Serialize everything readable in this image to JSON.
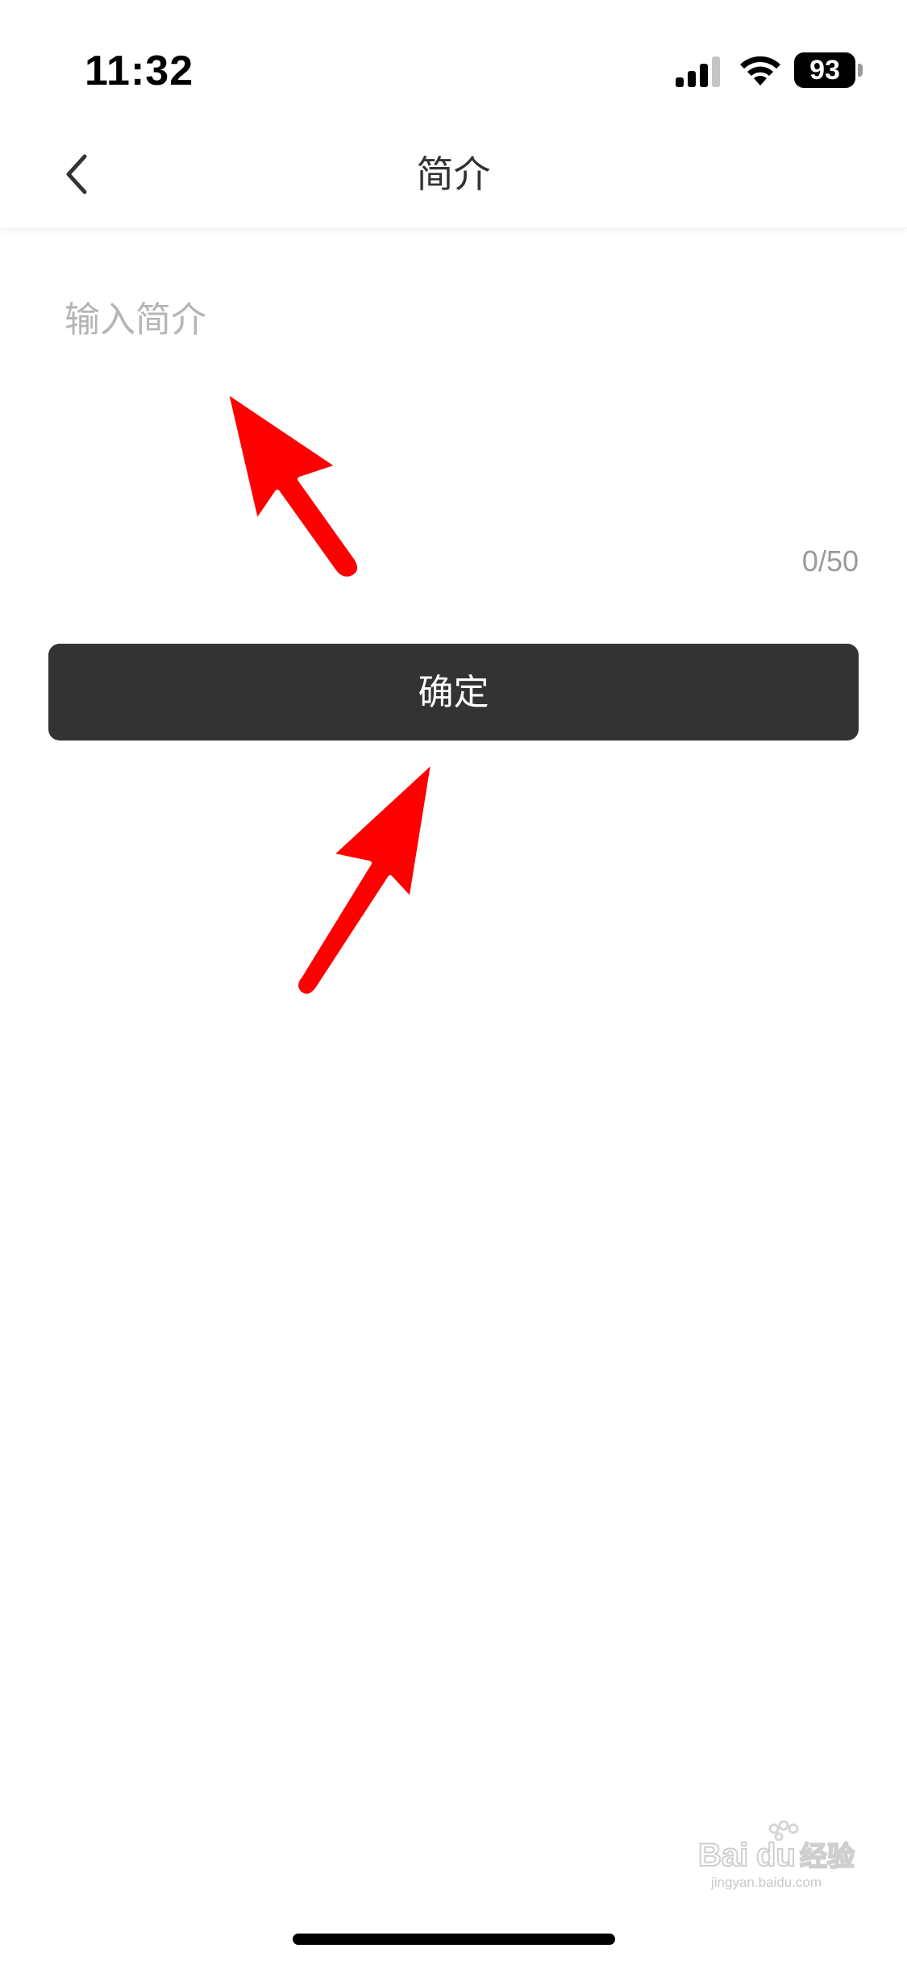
{
  "status_bar": {
    "time": "11:32",
    "battery_level": "93",
    "signal_bars": 4,
    "signal_bars_filled": 3,
    "icons": [
      "signal-icon",
      "wifi-icon",
      "battery-icon"
    ]
  },
  "nav": {
    "back_icon": "chevron-left-icon",
    "title": "简介"
  },
  "intro": {
    "placeholder": "输入简介",
    "value": "",
    "counter": "0/50"
  },
  "confirm": {
    "label": "确定"
  },
  "annotations": {
    "arrow_color": "#ff0000",
    "arrow_outline": "#ffffff",
    "icons": [
      "red-arrow-icon"
    ]
  },
  "watermark": {
    "brand": "Baidu 经验",
    "url": "jingyan.baidu.com"
  },
  "colors": {
    "button_bg": "#333333",
    "button_text": "#ffffff",
    "placeholder": "#b5b5b5",
    "counter": "#9a9a9a",
    "title": "#333333"
  }
}
